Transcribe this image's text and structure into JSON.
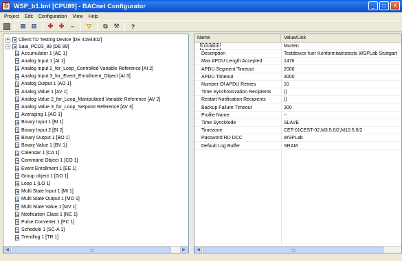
{
  "window": {
    "title": "WSP_b1.bnt [CPU89] - BACnet Configurator",
    "min_glyph": "_",
    "max_glyph": "□",
    "close_glyph": "X"
  },
  "menu": [
    "Project",
    "Edit",
    "Configuration",
    "View",
    "Help"
  ],
  "toolbar": [
    {
      "name": "stop-icon",
      "glyph": ""
    },
    {
      "name": "network-icon",
      "glyph": "⊞"
    },
    {
      "name": "network-2-icon",
      "glyph": "⊟"
    },
    {
      "name": "add-object-icon",
      "glyph": "✚"
    },
    {
      "name": "add-object-2-icon",
      "glyph": "✚"
    },
    {
      "name": "remove-icon",
      "glyph": "−"
    },
    {
      "name": "filter-icon",
      "glyph": "▽"
    },
    {
      "name": "copy-icon",
      "glyph": "⧉"
    },
    {
      "name": "tools-icon",
      "glyph": "⚒"
    },
    {
      "name": "help-icon",
      "glyph": "?"
    }
  ],
  "tree": {
    "client": {
      "expander": "+",
      "label": "Client:TD Testing Device [DE 4194302]"
    },
    "device": {
      "expander": "−",
      "label": "Saia_PCD3_89 [DE 89]"
    },
    "objects": [
      "Accumulator 1 [AC 1]",
      "Analog Input 1 [AI 1]",
      "Analog Input 2_for_Loop_Controlled Variable Reference [AI 2]",
      "Analog Input 3_for_Event_Enrollment_Object [AI 3]",
      "Analog Output 1 [AO 1]",
      "Analog Value 1 [AV 1]",
      "Analog Value 2_for_Loop_Manipulated Variable Reference [AV 2]",
      "Analog Value 3_for_Loop_Setpoint Reference [AV 3]",
      "Averaging 1 [AG 1]",
      "Binary Input 1 [BI 1]",
      "Binary Input 2 [BI 2]",
      "Binary Output 1 [BO 1]",
      "Binary Value 1 [BV 1]",
      "Calendar 1 [CA 1]",
      "Command Object 1 [CO 1]",
      "Event Enrollment 1 [EE 1]",
      "Group object 1 [GO 1]",
      "Loop 1 [LO 1]",
      "Multi State Input 1 [MI 1]",
      "Multi State Output 1 [MO 1]",
      "Multi State Value 1 [MV 1]",
      "Notification Class 1 [NC 1]",
      "Pulse Converter 1 [PC 1]",
      "Schedule 1 [SC-A 1]",
      "Trendlog 1 [TR 1]"
    ]
  },
  "properties": {
    "headers": {
      "name": "Name",
      "value": "Value/Link"
    },
    "rows": [
      {
        "name": "Location",
        "value": "Murten"
      },
      {
        "name": "Description",
        "value": "Testdevice fuer Konformitaetstests WSPLab Stuttgart"
      },
      {
        "name": "Max APDU Length Accepted",
        "value": "1476"
      },
      {
        "name": "APDU Segment Timeout",
        "value": "2000"
      },
      {
        "name": "APDU Timeout",
        "value": "3000"
      },
      {
        "name": "Number Of APDU Retries",
        "value": "10"
      },
      {
        "name": "Time Synchronization Recipients",
        "value": "()"
      },
      {
        "name": "Restart Notification Recipients",
        "value": "()"
      },
      {
        "name": "Backup Failure Timeout",
        "value": "300"
      },
      {
        "name": "Profile Name",
        "value": "--"
      },
      {
        "name": "Time SyncMode",
        "value": "SLAVE"
      },
      {
        "name": "Timezone",
        "value": "CET-01CEST-02,M3.5.0/2,M10.5.0/2"
      },
      {
        "name": "Password RD DCC",
        "value": "WSPLab"
      },
      {
        "name": "Default Log Buffer",
        "value": "SRAM"
      }
    ]
  },
  "scrollbars": {
    "left_arrow": "◀",
    "right_arrow": "▶"
  }
}
